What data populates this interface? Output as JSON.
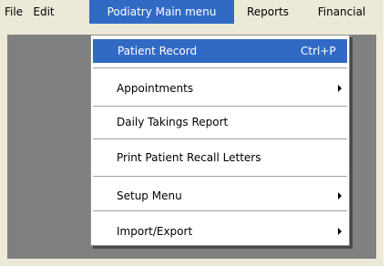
{
  "menubar": {
    "items": [
      {
        "label": "File"
      },
      {
        "label": "Edit"
      },
      {
        "label": "Podiatry Main menu"
      },
      {
        "label": "Reports"
      },
      {
        "label": "Financial"
      }
    ]
  },
  "dropdown": {
    "items": [
      {
        "label": "Patient Record",
        "shortcut": "Ctrl+P",
        "submenu": false,
        "highlighted": true
      },
      {
        "label": "Appointments",
        "shortcut": "",
        "submenu": true,
        "highlighted": false
      },
      {
        "label": "Daily Takings Report",
        "shortcut": "",
        "submenu": false,
        "highlighted": false
      },
      {
        "label": "Print Patient Recall Letters",
        "shortcut": "",
        "submenu": false,
        "highlighted": false
      },
      {
        "label": "Setup Menu",
        "shortcut": "",
        "submenu": true,
        "highlighted": false
      },
      {
        "label": "Import/Export",
        "shortcut": "",
        "submenu": true,
        "highlighted": false
      }
    ]
  },
  "colors": {
    "menubar_bg": "#ece9d8",
    "highlight": "#316ac5",
    "client_area": "#808080"
  }
}
